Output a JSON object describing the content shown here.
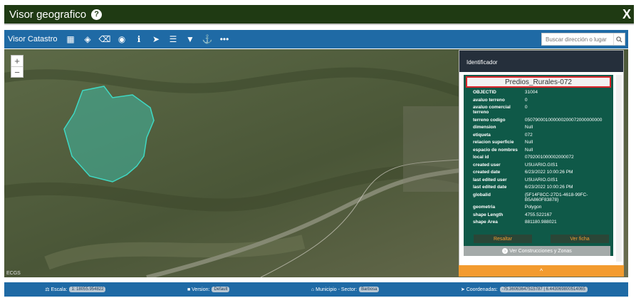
{
  "window": {
    "title": "Visor geografico",
    "close_label": "X"
  },
  "toolbar": {
    "app_name": "Visor Catastro",
    "tools": [
      {
        "icon": "table-icon",
        "glyph": "▦"
      },
      {
        "icon": "layers-icon",
        "glyph": "◈"
      },
      {
        "icon": "eraser-icon",
        "glyph": "⌫"
      },
      {
        "icon": "target-icon",
        "glyph": "◉"
      },
      {
        "icon": "info-icon",
        "glyph": "ℹ"
      },
      {
        "icon": "location-arrow-icon",
        "glyph": "➤"
      },
      {
        "icon": "list-icon",
        "glyph": "☰"
      },
      {
        "icon": "filter-icon",
        "glyph": "▼"
      },
      {
        "icon": "anchor-icon",
        "glyph": "⚓"
      },
      {
        "icon": "more-icon",
        "glyph": "•••"
      }
    ],
    "search_placeholder": "Buscar dirección o lugar"
  },
  "map": {
    "zoom_in": "+",
    "zoom_out": "−",
    "credit": "ECGS",
    "polygon_color": "#3fb8a3"
  },
  "identify": {
    "title": "Identificador",
    "feature_title": "Predios_Rurales-072",
    "attributes": [
      {
        "k": "OBJECTID",
        "v": "31004"
      },
      {
        "k": "avaluo terreno",
        "v": "0"
      },
      {
        "k": "avaluo comercial terreno",
        "v": "0"
      },
      {
        "k": "terreno codigo",
        "v": "050790001000000200072000000000"
      },
      {
        "k": "dimension",
        "v": "Null"
      },
      {
        "k": "etiqueta",
        "v": "072"
      },
      {
        "k": "relacion superficie",
        "v": "Null"
      },
      {
        "k": "espacio de nombres",
        "v": "Null"
      },
      {
        "k": "local id",
        "v": "0792001000002000072"
      },
      {
        "k": "created user",
        "v": "USUARIO.GIS1"
      },
      {
        "k": "created date",
        "v": "6/23/2022 10:00:26 PM"
      },
      {
        "k": "last edited user",
        "v": "USUARIO.GIS1"
      },
      {
        "k": "last edited date",
        "v": "6/23/2022 10:00:26 PM"
      },
      {
        "k": "globalid",
        "v": "{5F14F8CC-27D1-4618-99FC-B5A860F83878}"
      },
      {
        "k": "geometria",
        "v": "Polygon"
      },
      {
        "k": "shape Length",
        "v": "4755.522167"
      },
      {
        "k": "shape Area",
        "v": "881180.988021"
      }
    ],
    "resaltar_label": "Resaltar",
    "ver_ficha_label": "Ver ficha",
    "ver_construcciones_label": "Ver Construcciones y Zonas",
    "collapse_glyph": "^"
  },
  "status": {
    "escala_label": "Escala:",
    "escala_value": "1: 18055.954822",
    "version_label": "Version:",
    "version_value": "Default",
    "municipio_label": "Municipio - Sector:",
    "municipio_value": "Barbosa",
    "coord_label": "Coordenadas:",
    "coord_value": "-75.36063647515787 | 6.443069800514065"
  },
  "colors": {
    "title_bg": "#1f3a13",
    "toolbar_bg": "#1f6aa5",
    "panel_body": "#0f5948",
    "accent": "#f39b2f",
    "highlight_border": "#d9252a"
  }
}
